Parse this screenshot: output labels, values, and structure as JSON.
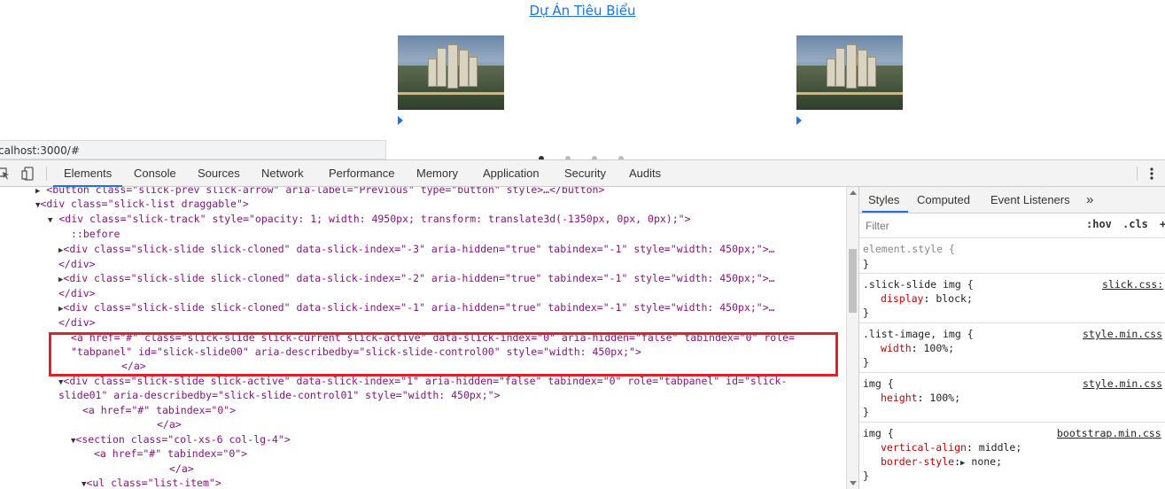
{
  "page": {
    "heading": "Dự Án Tiêu Biểu",
    "url_tooltip": "calhost:3000/#"
  },
  "colors": {
    "accent": "#1a73e8",
    "highlight": "#e0202a",
    "tag": "#881280",
    "attr": "#994500",
    "value": "#1a1aa6",
    "prop": "#c80000"
  },
  "devtools": {
    "tabs": [
      "Elements",
      "Console",
      "Sources",
      "Network",
      "Performance",
      "Memory",
      "Application",
      "Security",
      "Audits"
    ],
    "active_tab": "Elements",
    "icons": [
      "inspect-icon",
      "device-toolbar-icon",
      "more-options-icon"
    ],
    "dom_lines": [
      "<button class=\"slick-prev slick-arrow\" aria-label=\"Previous\" type=\"button\" style>…</button>",
      "<div class=\"slick-list draggable\">",
      "<div class=\"slick-track\" style=\"opacity: 1; width: 4950px; transform: translate3d(-1350px, 0px, 0px);\">",
      "::before",
      "<div class=\"slick-slide slick-cloned\" data-slick-index=\"-3\" aria-hidden=\"true\" tabindex=\"-1\" style=\"width: 450px;\">…",
      "</div>",
      "<div class=\"slick-slide slick-cloned\" data-slick-index=\"-2\" aria-hidden=\"true\" tabindex=\"-1\" style=\"width: 450px;\">…",
      "</div>",
      "<div class=\"slick-slide slick-cloned\" data-slick-index=\"-1\" aria-hidden=\"true\" tabindex=\"-1\" style=\"width: 450px;\">…",
      "</div>",
      "<a href=\"#\" class=\"slick-slide slick-current slick-active\" data-slick-index=\"0\" aria-hidden=\"false\" tabindex=\"0\" role=",
      "\"tabpanel\" id=\"slick-slide00\" aria-describedby=\"slick-slide-control00\" style=\"width: 450px;\">",
      "</a>",
      "<div class=\"slick-slide slick-active\" data-slick-index=\"1\" aria-hidden=\"false\" tabindex=\"0\" role=\"tabpanel\" id=\"slick-",
      "slide01\" aria-describedby=\"slick-slide-control01\" style=\"width: 450px;\">",
      "<a href=\"#\" tabindex=\"0\">",
      "</a>",
      "<section class=\"col-xs-6 col-lg-4\">",
      "<a href=\"#\" tabindex=\"0\">",
      "</a>",
      "<ul class=\"list-item\">"
    ]
  },
  "styles_panel": {
    "tabs": [
      "Styles",
      "Computed",
      "Event Listeners",
      "»"
    ],
    "active_tab": "Styles",
    "filter_placeholder": "Filter",
    "hov_label": ":hov",
    "cls_label": ".cls",
    "add_label": "+",
    "rules": [
      {
        "selector": "element.style {",
        "source": "",
        "props": [],
        "close": "}"
      },
      {
        "selector": ".slick-slide img {",
        "source": "slick.css:",
        "props": [
          {
            "name": "display",
            "value": "block;"
          }
        ],
        "close": "}"
      },
      {
        "selector": ".list-image, img {",
        "source": "style.min.css",
        "props": [
          {
            "name": "width",
            "value": "100%;"
          }
        ],
        "close": "}"
      },
      {
        "selector": "img {",
        "source": "style.min.css",
        "props": [
          {
            "name": "height",
            "value": "100%;"
          }
        ],
        "close": "}"
      },
      {
        "selector": "img {",
        "source": "bootstrap.min.css",
        "props": [
          {
            "name": "vertical-align",
            "value": "middle;"
          },
          {
            "name": "border-style",
            "value": "none;"
          }
        ],
        "close": "}"
      }
    ]
  }
}
